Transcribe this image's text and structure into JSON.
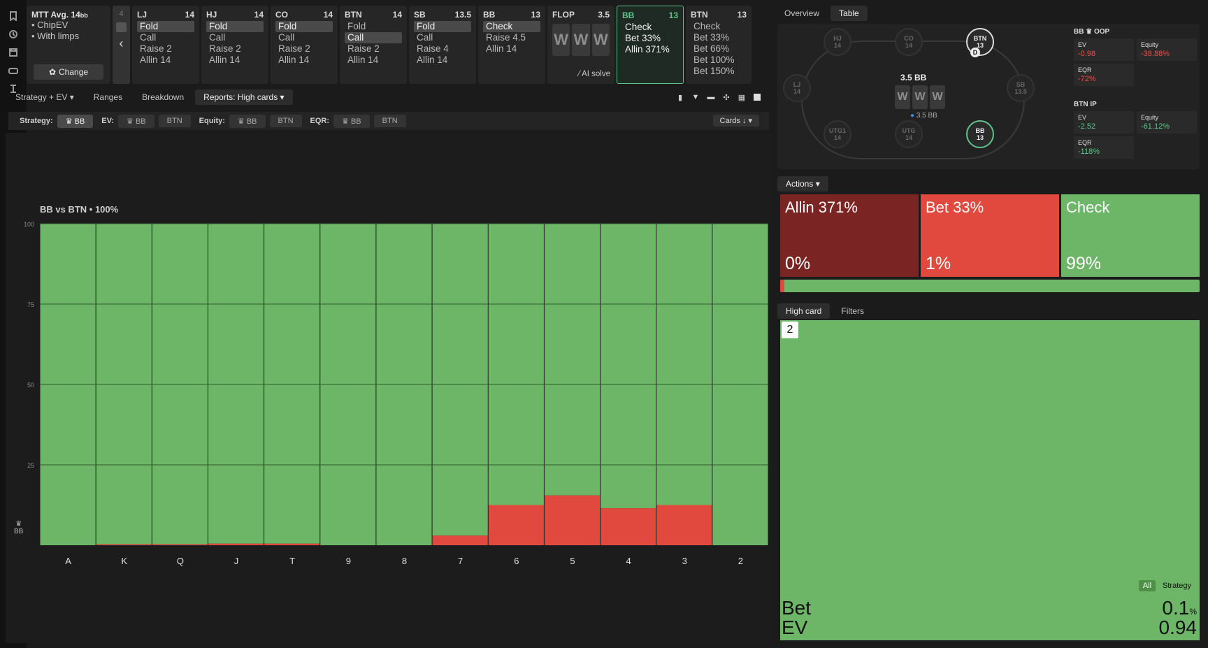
{
  "rail_icons": [
    "bookmark-icon",
    "history-icon",
    "save-icon",
    "gamepad-icon",
    "text-cursor-icon"
  ],
  "mtt": {
    "title": "MTT",
    "avg": "Avg. 14",
    "avg_unit": "bb",
    "items": [
      "ChipEV",
      "With limps"
    ],
    "change_label": "Change"
  },
  "nav": {
    "count": "4"
  },
  "positions": [
    {
      "pos": "LJ",
      "stack": "14",
      "options": [
        "Fold",
        "Call",
        "Raise 2",
        "Allin 14"
      ],
      "selected": 0
    },
    {
      "pos": "HJ",
      "stack": "14",
      "options": [
        "Fold",
        "Call",
        "Raise 2",
        "Allin 14"
      ],
      "selected": 0
    },
    {
      "pos": "CO",
      "stack": "14",
      "options": [
        "Fold",
        "Call",
        "Raise 2",
        "Allin 14"
      ],
      "selected": 0
    },
    {
      "pos": "BTN",
      "stack": "14",
      "options": [
        "Fold",
        "Call",
        "Raise 2",
        "Allin 14"
      ],
      "selected": 1
    },
    {
      "pos": "SB",
      "stack": "13.5",
      "options": [
        "Fold",
        "Call",
        "Raise 4",
        "Allin 14"
      ],
      "selected": 0
    },
    {
      "pos": "BB",
      "stack": "13",
      "options": [
        "Check",
        "Raise 4.5",
        "Allin 14"
      ],
      "selected": 0
    }
  ],
  "flop": {
    "label": "FLOP",
    "pot": "3.5",
    "cards": [
      "W",
      "W",
      "W"
    ],
    "ai_label": "AI solve"
  },
  "bb_current": {
    "pos": "BB",
    "stack": "13",
    "options": [
      "Check",
      "Bet 33%",
      "Allin 371%"
    ]
  },
  "btn_next": {
    "pos": "BTN",
    "stack": "13",
    "options": [
      "Check",
      "Bet 33%",
      "Bet 66%",
      "Bet 100%",
      "Bet 150%"
    ]
  },
  "tabs": [
    "Strategy + EV",
    "Ranges",
    "Breakdown",
    "Reports: High cards"
  ],
  "filters": {
    "strategy_label": "Strategy:",
    "strategy": "BB",
    "ev_label": "EV:",
    "ev": [
      "BB",
      "BTN"
    ],
    "equity_label": "Equity:",
    "equity": [
      "BB",
      "BTN"
    ],
    "eqr_label": "EQR:",
    "eqr": [
      "BB",
      "BTN"
    ],
    "sort": "Cards"
  },
  "chart_data": {
    "type": "bar",
    "stacked": true,
    "title": "BB vs BTN • 100%",
    "categories": [
      "A",
      "K",
      "Q",
      "J",
      "T",
      "9",
      "8",
      "7",
      "6",
      "5",
      "4",
      "3",
      "2"
    ],
    "series": [
      {
        "name": "Bet",
        "color": "#e1493f",
        "values": [
          0,
          0.3,
          0.3,
          0.5,
          0.5,
          0,
          0,
          3,
          12.5,
          15.5,
          11.5,
          12.5,
          0
        ]
      },
      {
        "name": "Check",
        "color": "#6db567",
        "values": [
          100,
          99.7,
          99.7,
          99.5,
          99.5,
          100,
          100,
          97,
          87.5,
          84.5,
          88.5,
          87.5,
          100
        ]
      }
    ],
    "ylim": [
      0,
      100
    ],
    "yticks": [
      "100",
      "75",
      "50",
      "25"
    ],
    "ylabel": "BB",
    "grid": true
  },
  "right_tabs": [
    "Overview",
    "Table"
  ],
  "table": {
    "pot": "3.5 BB",
    "pot_chip": "3.5 BB",
    "seats": [
      {
        "pos": "HJ",
        "stack": "14"
      },
      {
        "pos": "CO",
        "stack": "14"
      },
      {
        "pos": "BTN",
        "stack": "13"
      },
      {
        "pos": "LJ",
        "stack": "14"
      },
      {
        "pos": "SB",
        "stack": "13.5"
      },
      {
        "pos": "UTG1",
        "stack": "14"
      },
      {
        "pos": "UTG",
        "stack": "14"
      },
      {
        "pos": "BB",
        "stack": "13"
      }
    ],
    "dealer": "D",
    "bb_stats": {
      "title": "BB",
      "role": "OOP",
      "ev_label": "EV",
      "ev": "-0.98",
      "equity_label": "Equity",
      "equity": "-38.88%",
      "eqr_label": "EQR",
      "eqr": "-72%"
    },
    "btn_stats": {
      "title": "BTN",
      "role": "IP",
      "ev_label": "EV",
      "ev": "-2.52",
      "equity_label": "Equity",
      "equity": "-61.12%",
      "eqr_label": "EQR",
      "eqr": "-118%"
    }
  },
  "actions_label": "Actions",
  "actions": [
    {
      "name": "Allin 371%",
      "pct": "0%",
      "color": "#7a2523"
    },
    {
      "name": "Bet 33%",
      "pct": "1%",
      "color": "#e1493f"
    },
    {
      "name": "Check",
      "pct": "99%",
      "color": "#6db567"
    }
  ],
  "bet_frequency": 0.01,
  "high_tabs": [
    "High card",
    "Filters"
  ],
  "cell": {
    "card": "2",
    "toggle_all": "All",
    "toggle_strategy": "Strategy",
    "bet_label": "Bet",
    "bet_value": "0.1",
    "bet_unit": "%",
    "ev_label": "EV",
    "ev_value": "0.94"
  }
}
